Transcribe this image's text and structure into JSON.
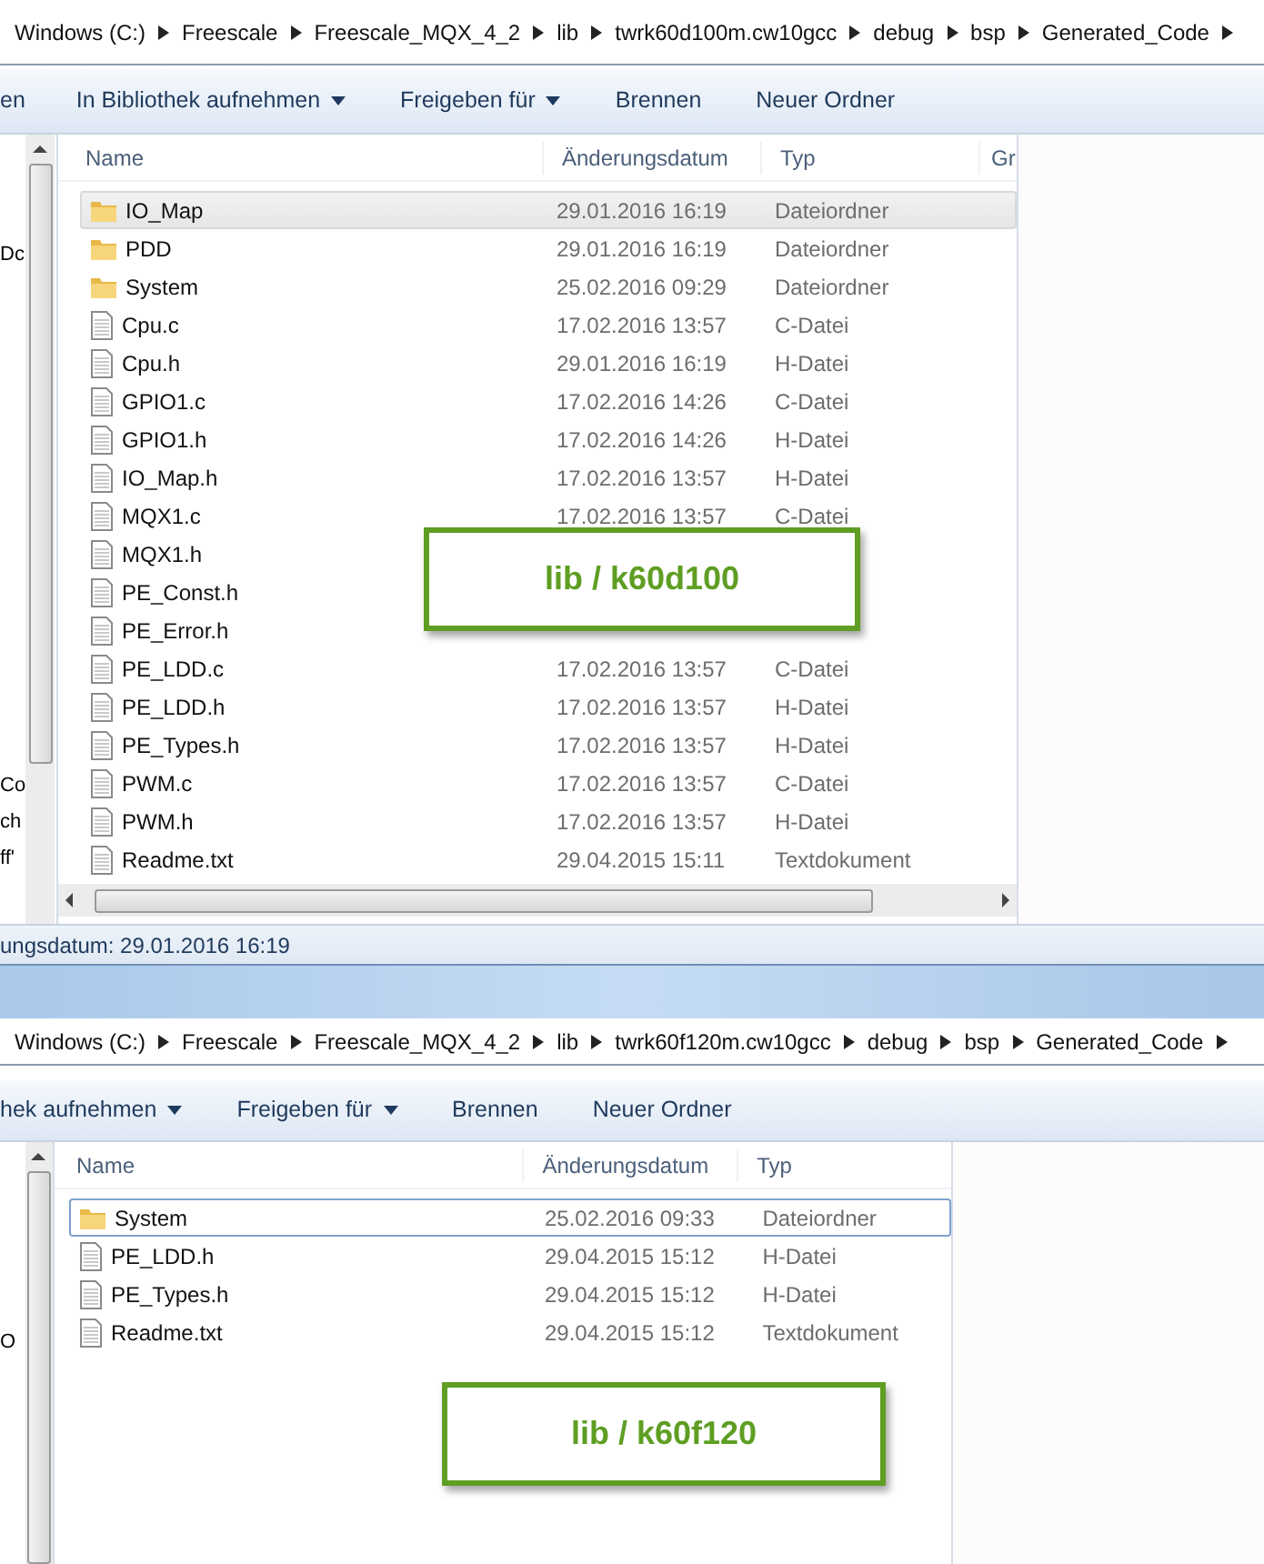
{
  "windows": [
    {
      "active": false,
      "breadcrumb": [
        "Windows (C:)",
        "Freescale",
        "Freescale_MQX_4_2",
        "lib",
        "twrk60d100m.cw10gcc",
        "debug",
        "bsp",
        "Generated_Code"
      ],
      "toolbar": [
        {
          "label": "en",
          "dropdown": false
        },
        {
          "label": "In Bibliothek aufnehmen",
          "dropdown": true
        },
        {
          "label": "Freigeben für",
          "dropdown": true
        },
        {
          "label": "Brennen",
          "dropdown": false
        },
        {
          "label": "Neuer Ordner",
          "dropdown": false
        }
      ],
      "columns": [
        "Name",
        "Änderungsdatum",
        "Typ",
        "Gr"
      ],
      "nav_fragments_top": [
        "Dc"
      ],
      "nav_fragments_bottom": [
        "Co",
        "ch",
        "ff'"
      ],
      "rows": [
        {
          "name": "IO_Map",
          "date": "29.01.2016 16:19",
          "type": "Dateiordner",
          "kind": "folder",
          "selected": true
        },
        {
          "name": "PDD",
          "date": "29.01.2016 16:19",
          "type": "Dateiordner",
          "kind": "folder",
          "selected": false
        },
        {
          "name": "System",
          "date": "25.02.2016 09:29",
          "type": "Dateiordner",
          "kind": "folder",
          "selected": false
        },
        {
          "name": "Cpu.c",
          "date": "17.02.2016 13:57",
          "type": "C-Datei",
          "kind": "file",
          "selected": false
        },
        {
          "name": "Cpu.h",
          "date": "29.01.2016 16:19",
          "type": "H-Datei",
          "kind": "file",
          "selected": false
        },
        {
          "name": "GPIO1.c",
          "date": "17.02.2016 14:26",
          "type": "C-Datei",
          "kind": "file",
          "selected": false
        },
        {
          "name": "GPIO1.h",
          "date": "17.02.2016 14:26",
          "type": "H-Datei",
          "kind": "file",
          "selected": false
        },
        {
          "name": "IO_Map.h",
          "date": "17.02.2016 13:57",
          "type": "H-Datei",
          "kind": "file",
          "selected": false
        },
        {
          "name": "MQX1.c",
          "date": "17.02.2016 13:57",
          "type": "C-Datei",
          "kind": "file",
          "selected": false
        },
        {
          "name": "MQX1.h",
          "kind": "file",
          "selected": false
        },
        {
          "name": "PE_Const.h",
          "kind": "file",
          "selected": false
        },
        {
          "name": "PE_Error.h",
          "kind": "file",
          "selected": false
        },
        {
          "name": "PE_LDD.c",
          "date": "17.02.2016 13:57",
          "type": "C-Datei",
          "kind": "file",
          "selected": false
        },
        {
          "name": "PE_LDD.h",
          "date": "17.02.2016 13:57",
          "type": "H-Datei",
          "kind": "file",
          "selected": false
        },
        {
          "name": "PE_Types.h",
          "date": "17.02.2016 13:57",
          "type": "H-Datei",
          "kind": "file",
          "selected": false
        },
        {
          "name": "PWM.c",
          "date": "17.02.2016 13:57",
          "type": "C-Datei",
          "kind": "file",
          "selected": false
        },
        {
          "name": "PWM.h",
          "date": "17.02.2016 13:57",
          "type": "H-Datei",
          "kind": "file",
          "selected": false
        },
        {
          "name": "Readme.txt",
          "date": "29.04.2015 15:11",
          "type": "Textdokument",
          "kind": "file",
          "selected": false
        }
      ],
      "status": "ungsdatum: 29.01.2016 16:19",
      "callout": "lib / k60d100"
    },
    {
      "active": true,
      "breadcrumb": [
        "Windows (C:)",
        "Freescale",
        "Freescale_MQX_4_2",
        "lib",
        "twrk60f120m.cw10gcc",
        "debug",
        "bsp",
        "Generated_Code"
      ],
      "toolbar": [
        {
          "label": "hek aufnehmen",
          "dropdown": true
        },
        {
          "label": "Freigeben für",
          "dropdown": true
        },
        {
          "label": "Brennen",
          "dropdown": false
        },
        {
          "label": "Neuer Ordner",
          "dropdown": false
        }
      ],
      "columns": [
        "Name",
        "Änderungsdatum",
        "Typ"
      ],
      "nav_fragments_top": [
        "O"
      ],
      "rows": [
        {
          "name": "System",
          "date": "25.02.2016 09:33",
          "type": "Dateiordner",
          "kind": "folder",
          "selected": true
        },
        {
          "name": "PE_LDD.h",
          "date": "29.04.2015 15:12",
          "type": "H-Datei",
          "kind": "file",
          "selected": false
        },
        {
          "name": "PE_Types.h",
          "date": "29.04.2015 15:12",
          "type": "H-Datei",
          "kind": "file",
          "selected": false
        },
        {
          "name": "Readme.txt",
          "date": "29.04.2015 15:12",
          "type": "Textdokument",
          "kind": "file",
          "selected": false
        }
      ],
      "callout": "lib / k60f120"
    }
  ]
}
